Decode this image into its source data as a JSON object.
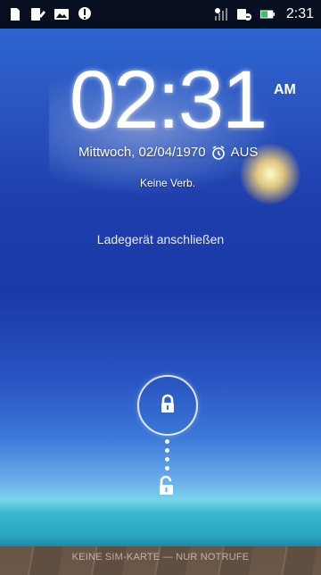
{
  "status_bar": {
    "time": "2:31"
  },
  "lockscreen": {
    "time": "02:31",
    "ampm": "AM",
    "date": "Mittwoch, 02/04/1970",
    "alarm_status": "AUS",
    "connection": "Keine Verb.",
    "charging_text": "Ladegerät anschließen",
    "sim_status": "KEINE SIM-KARTE — NUR NOTRUFE"
  }
}
